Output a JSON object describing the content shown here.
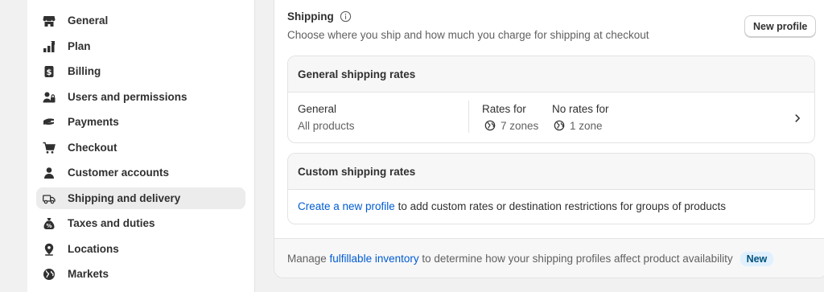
{
  "sidebar": {
    "items": [
      {
        "label": "General",
        "icon": "store-icon"
      },
      {
        "label": "Plan",
        "icon": "plan-icon"
      },
      {
        "label": "Billing",
        "icon": "billing-icon"
      },
      {
        "label": "Users and permissions",
        "icon": "users-icon"
      },
      {
        "label": "Payments",
        "icon": "payments-icon"
      },
      {
        "label": "Checkout",
        "icon": "cart-icon"
      },
      {
        "label": "Customer accounts",
        "icon": "person-icon"
      },
      {
        "label": "Shipping and delivery",
        "icon": "truck-icon",
        "active": true
      },
      {
        "label": "Taxes and duties",
        "icon": "tax-icon"
      },
      {
        "label": "Locations",
        "icon": "location-icon"
      },
      {
        "label": "Markets",
        "icon": "globe-icon"
      }
    ]
  },
  "shipping": {
    "title": "Shipping",
    "subtitle": "Choose where you ship and how much you charge for shipping at checkout",
    "new_profile_button": "New profile",
    "general_rates": {
      "header": "General shipping rates",
      "profile_name": "General",
      "profile_scope": "All products",
      "rates_for_label": "Rates for",
      "rates_for_value": "7 zones",
      "no_rates_label": "No rates for",
      "no_rates_value": "1 zone"
    },
    "custom_rates": {
      "header": "Custom shipping rates",
      "link_text": "Create a new profile",
      "body_text": " to add custom rates or destination restrictions for groups of products"
    },
    "footer": {
      "prefix": "Manage ",
      "link_text": "fulfillable inventory",
      "suffix": " to determine how your shipping profiles affect product availability",
      "badge": "New"
    }
  },
  "colors": {
    "link": "#005bd3",
    "badge_bg": "#e0f0ff",
    "badge_text": "#00527c",
    "active_nav_bg": "#ececec"
  }
}
